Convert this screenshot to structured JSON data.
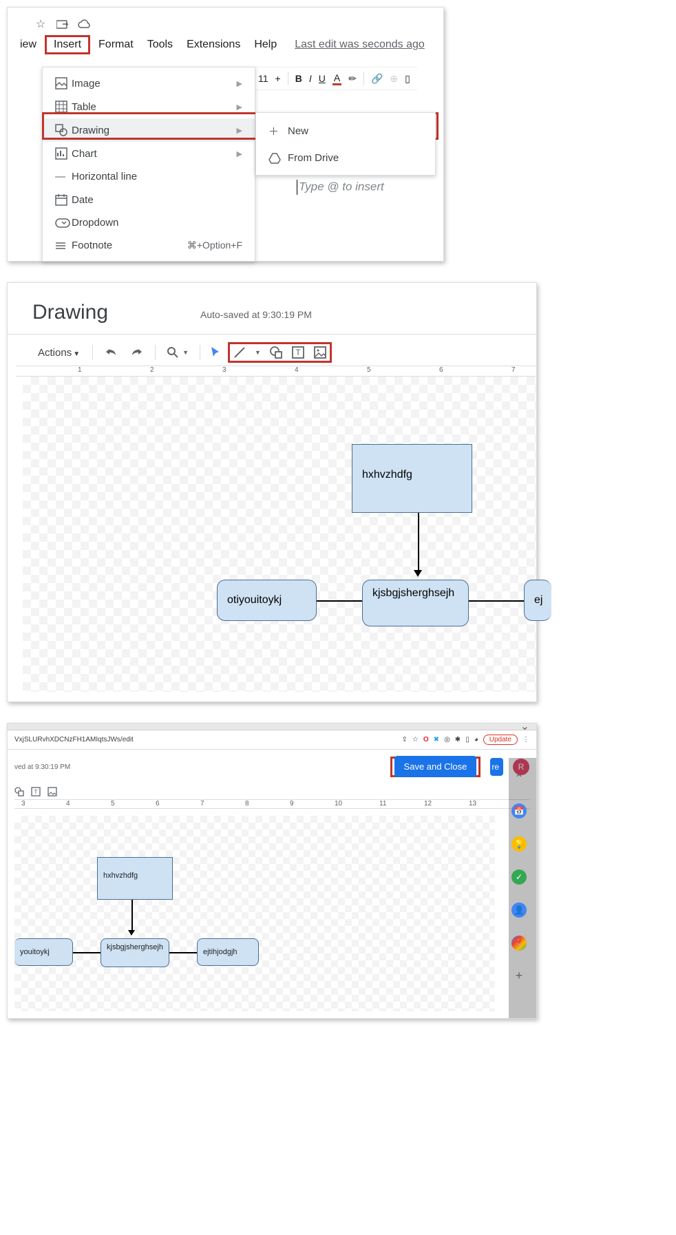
{
  "panel1": {
    "menubar": {
      "view": "iew",
      "insert": "Insert",
      "format": "Format",
      "tools": "Tools",
      "extensions": "Extensions",
      "help": "Help",
      "last_edit": "Last edit was seconds ago"
    },
    "toolbar": {
      "font_size": "11",
      "minus": "−",
      "plus": "+"
    },
    "insert_items": {
      "image": "Image",
      "table": "Table",
      "drawing": "Drawing",
      "chart": "Chart",
      "hline": "Horizontal line",
      "date": "Date",
      "dropdown": "Dropdown",
      "footnote": "Footnote",
      "footnote_shortcut": "⌘+Option+F"
    },
    "submenu": {
      "new": "New",
      "from_drive": "From Drive"
    },
    "doc_placeholder": "Type @ to insert"
  },
  "panel2": {
    "title": "Drawing",
    "saved": "Auto-saved at 9:30:19 PM",
    "actions": "Actions",
    "ruler": [
      "1",
      "2",
      "3",
      "4",
      "5",
      "6",
      "7"
    ],
    "shapes": {
      "top": "hxhvzhdfg",
      "left": "otiyouitoykj",
      "mid": "kjsbgjsherghsejh",
      "right": "ej"
    }
  },
  "panel3": {
    "url": "VxjSLURvhXDCNzFH1AMIqtsJWs/edit",
    "update": "Update",
    "saved": "ved at 9:30:19 PM",
    "save_close": "Save and Close",
    "share_fragment": "re",
    "avatar_letter": "R",
    "ruler": [
      "3",
      "4",
      "5",
      "6",
      "7",
      "8",
      "9",
      "10",
      "11",
      "12",
      "13"
    ],
    "shapes": {
      "top": "hxhvzhdfg",
      "left": "youitoykj",
      "mid": "kjsbgjsherghsejh",
      "right": "ejtihjodgjh"
    }
  }
}
